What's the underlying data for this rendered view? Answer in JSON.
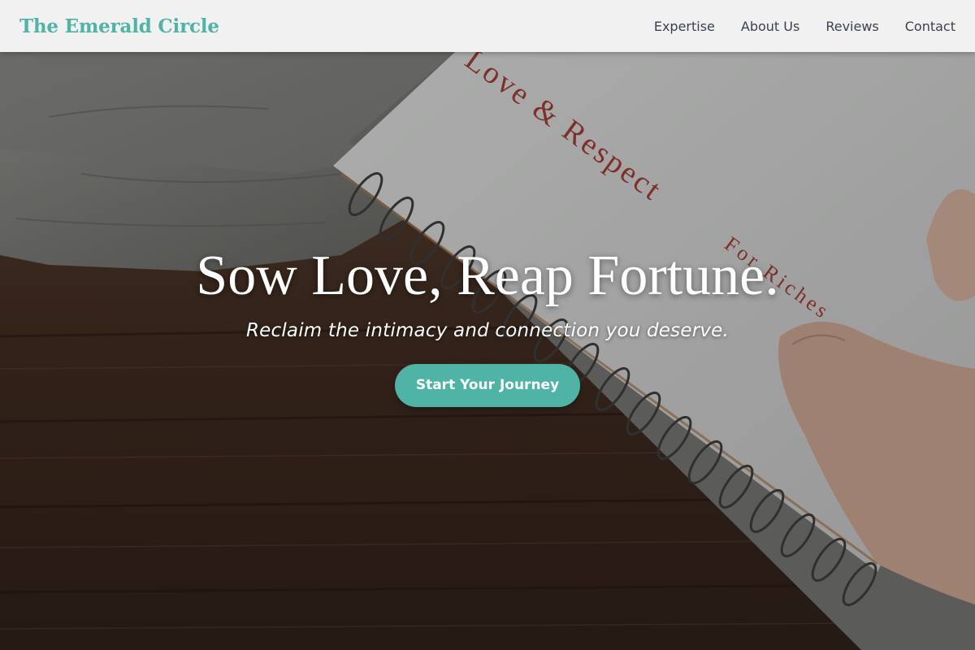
{
  "header": {
    "brand": "The Emerald Circle",
    "nav": [
      {
        "label": "Expertise"
      },
      {
        "label": "About Us"
      },
      {
        "label": "Reviews"
      },
      {
        "label": "Contact"
      }
    ]
  },
  "hero": {
    "title": "Sow Love, Reap Fortune.",
    "subtitle": "Reclaim the intimacy and connection you deserve.",
    "cta_label": "Start Your Journey",
    "book_title": "Love & Respect",
    "book_subtitle": "For Riches"
  },
  "colors": {
    "accent": "#4fb3a6",
    "header_bg": "#f1f1f1",
    "nav_text": "#3a4150"
  },
  "icons": [
    "hero-photo"
  ]
}
